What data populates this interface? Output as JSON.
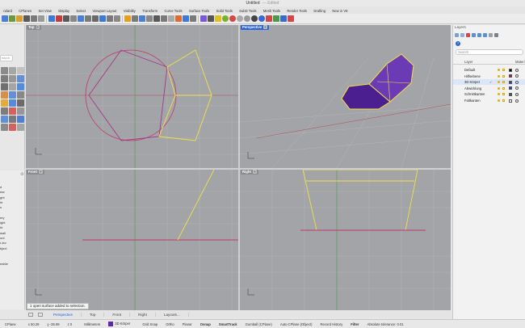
{
  "window": {
    "title": "Untitled",
    "state": "Edited"
  },
  "tabs": [
    "ndard",
    "CPlanes",
    "Set View",
    "Display",
    "Select",
    "Viewport Layout",
    "Visibility",
    "Transform",
    "Curve Tools",
    "Surface Tools",
    "Solid Tools",
    "SubD Tools",
    "Mesh Tools",
    "Render Tools",
    "Drafting",
    "New in V8"
  ],
  "left_search": {
    "placeholder": "earch"
  },
  "left_panel_items": [
    "d",
    "ear",
    "ght",
    "ht",
    "n",
    "",
    "ery",
    "ight",
    "ht",
    "wall",
    "ont",
    "r-lev",
    "bject",
    "",
    "",
    "eable"
  ],
  "viewports": {
    "top": "Top",
    "perspective": "Perspective",
    "front": "Front",
    "right": "Right",
    "plus": "+"
  },
  "status_message": "1 open surface added to selection.",
  "viewport_tabs": [
    "Perspective",
    "Top",
    "Front",
    "Right",
    "Layouts..."
  ],
  "statusbar": {
    "cplane": "CPlane",
    "x": "x 50.29",
    "y": "y -35.99",
    "z": "z 0",
    "units": "Millimeters",
    "layer": "3D Körper",
    "layer_color": "#5c2aa2",
    "grid_snap": "Grid Snap",
    "ortho": "Ortho",
    "planar": "Planar",
    "osnap": "Osnap",
    "smarttrack": "SmartTrack",
    "gumball": "Gumball (CPlane)",
    "autocplane": "Auto CPlane (Object)",
    "record_history": "Record History",
    "filter": "Filter",
    "tolerance": "Absolute tolerance: 0.01"
  },
  "layers_panel": {
    "title": "Layers",
    "search_placeholder": "Search",
    "help": "?",
    "col_layer": "Layer",
    "col_material": "Materi",
    "current_check": "✓",
    "rows": [
      {
        "name": "Default",
        "color": "#000000",
        "current": false
      },
      {
        "name": "Hilfsebene",
        "color": "#c8102e",
        "current": false
      },
      {
        "name": "3D Körper",
        "color": "#5c2aa2",
        "current": true
      },
      {
        "name": "Abwicklung",
        "color": "#1a3fd6",
        "current": false
      },
      {
        "name": "Schnittkanten",
        "color": "#1f7a1f",
        "current": false
      },
      {
        "name": "Faltkanten",
        "color": "#ffffff",
        "current": false
      }
    ]
  },
  "colors": {
    "accent": "#2a65d8",
    "viewport_bg": "#a2a4a7",
    "solid_purple": "#4b1f8f",
    "curve_yellow": "#f2e04a",
    "curve_red": "#c0396b"
  }
}
